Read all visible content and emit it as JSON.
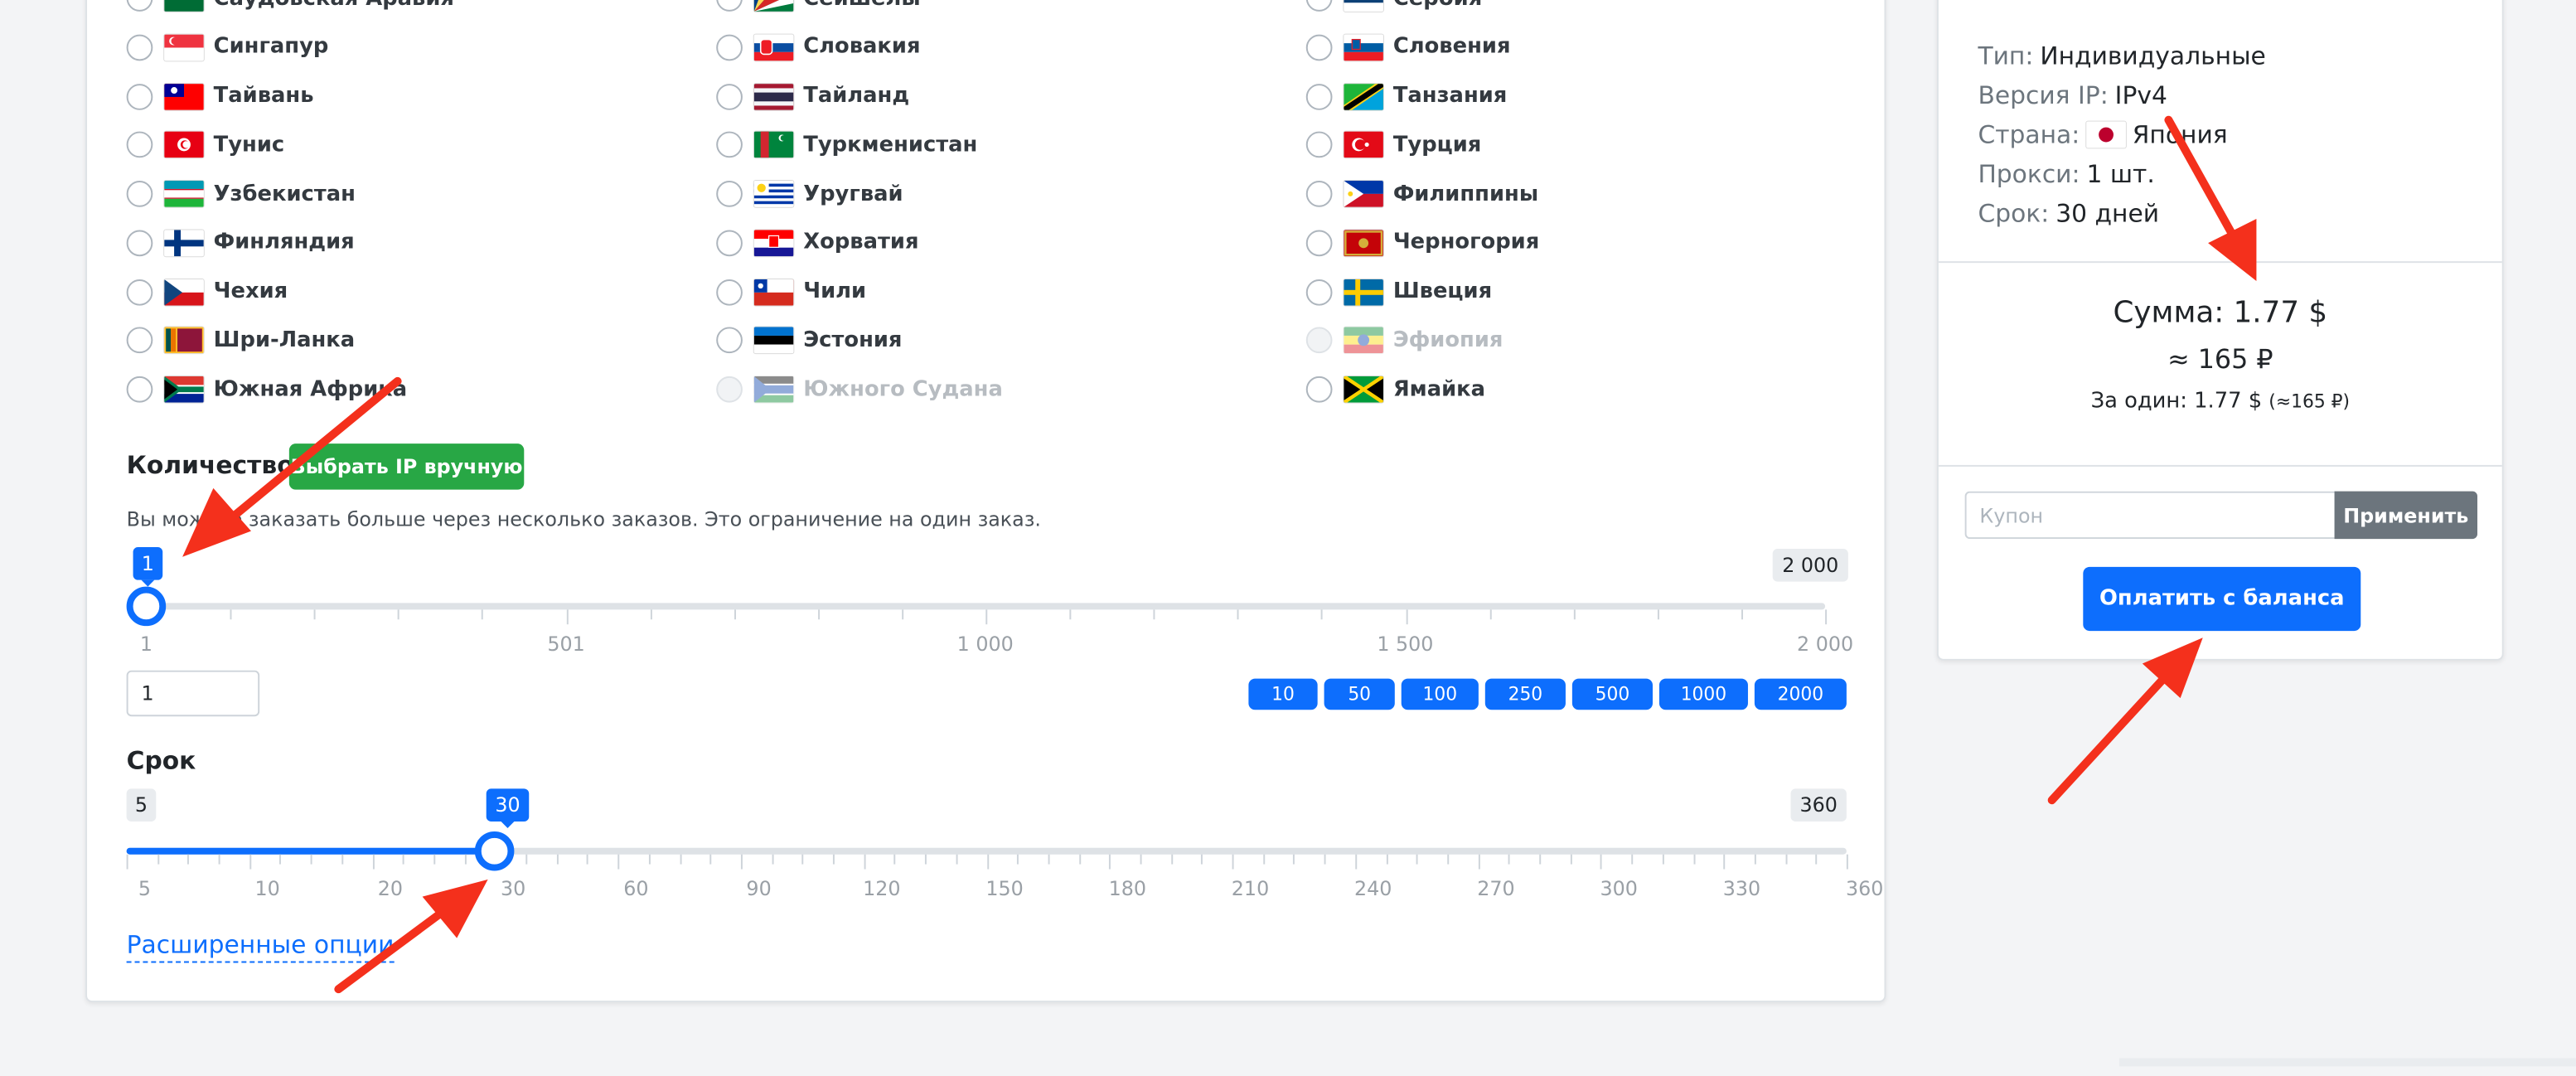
{
  "countries": [
    [
      {
        "name": "Саудовская Аравия",
        "flag": "sa",
        "enabled": true
      },
      {
        "name": "Сингапур",
        "flag": "sg",
        "enabled": true
      },
      {
        "name": "Тайвань",
        "flag": "tw",
        "enabled": true
      },
      {
        "name": "Тунис",
        "flag": "tn",
        "enabled": true
      },
      {
        "name": "Узбекистан",
        "flag": "uz",
        "enabled": true
      },
      {
        "name": "Финляндия",
        "flag": "fi",
        "enabled": true
      },
      {
        "name": "Чехия",
        "flag": "cz",
        "enabled": true
      },
      {
        "name": "Шри-Ланка",
        "flag": "lk",
        "enabled": true
      },
      {
        "name": "Южная Африка",
        "flag": "za",
        "enabled": true
      }
    ],
    [
      {
        "name": "Сейшелы",
        "flag": "sc",
        "enabled": true
      },
      {
        "name": "Словакия",
        "flag": "sk",
        "enabled": true
      },
      {
        "name": "Тайланд",
        "flag": "th",
        "enabled": true
      },
      {
        "name": "Туркменистан",
        "flag": "tm",
        "enabled": true
      },
      {
        "name": "Уругвай",
        "flag": "uy",
        "enabled": true
      },
      {
        "name": "Хорватия",
        "flag": "hr",
        "enabled": true
      },
      {
        "name": "Чили",
        "flag": "cl",
        "enabled": true
      },
      {
        "name": "Эстония",
        "flag": "ee",
        "enabled": true
      },
      {
        "name": "Южного Судана",
        "flag": "ss",
        "enabled": false
      }
    ],
    [
      {
        "name": "Сербия",
        "flag": "rs",
        "enabled": true
      },
      {
        "name": "Словения",
        "flag": "si",
        "enabled": true
      },
      {
        "name": "Танзания",
        "flag": "tz",
        "enabled": true
      },
      {
        "name": "Турция",
        "flag": "tr",
        "enabled": true
      },
      {
        "name": "Филиппины",
        "flag": "ph",
        "enabled": true
      },
      {
        "name": "Черногория",
        "flag": "me",
        "enabled": true
      },
      {
        "name": "Швеция",
        "flag": "se",
        "enabled": true
      },
      {
        "name": "Эфиопия",
        "flag": "et",
        "enabled": false
      },
      {
        "name": "Ямайка",
        "flag": "jm",
        "enabled": true
      }
    ]
  ],
  "quantity": {
    "title": "Количество",
    "manual_button": "Выбрать IP вручную",
    "hint": "Вы можете заказать больше через несколько заказов. Это ограничение на один заказ.",
    "value": 1,
    "min": 1,
    "max": 2000,
    "value_label": "1",
    "max_label": "2 000",
    "scale": [
      {
        "v": 1,
        "label": "1"
      },
      {
        "v": 501,
        "label": "501"
      },
      {
        "v": 1000,
        "label": "1 000"
      },
      {
        "v": 1500,
        "label": "1 500"
      },
      {
        "v": 2000,
        "label": "2 000"
      }
    ],
    "input_value": "1",
    "presets": [
      "10",
      "50",
      "100",
      "250",
      "500",
      "1000",
      "2000"
    ]
  },
  "term": {
    "title": "Срок",
    "value": 30,
    "value_label": "30",
    "min_label": "5",
    "max_label": "360",
    "scale": [
      "5",
      "10",
      "20",
      "30",
      "60",
      "90",
      "120",
      "150",
      "180",
      "210",
      "240",
      "270",
      "300",
      "330",
      "360"
    ]
  },
  "advanced_link": "Расширенные опции",
  "summary": {
    "type_label": "Тип:",
    "type_value": "Индивидуальные",
    "ip_label": "Версия IP:",
    "ip_value": "IPv4",
    "country_label": "Страна:",
    "country_value": "Япония",
    "proxy_label": "Прокси:",
    "proxy_value": "1 шт.",
    "term_label": "Срок:",
    "term_value": "30 дней",
    "total": "Сумма: 1.77 $",
    "total_rub": "≈ 165 ₽",
    "per_one": "За один: 1.77 $",
    "per_one_rub": "(≈165 ₽)",
    "coupon_placeholder": "Купон",
    "apply_button": "Применить",
    "pay_button": "Оплатить с баланса"
  },
  "colors": {
    "accent": "#0d6efd",
    "success": "#28a745",
    "secondary": "#6c757d",
    "annotation": "#f4301c"
  }
}
